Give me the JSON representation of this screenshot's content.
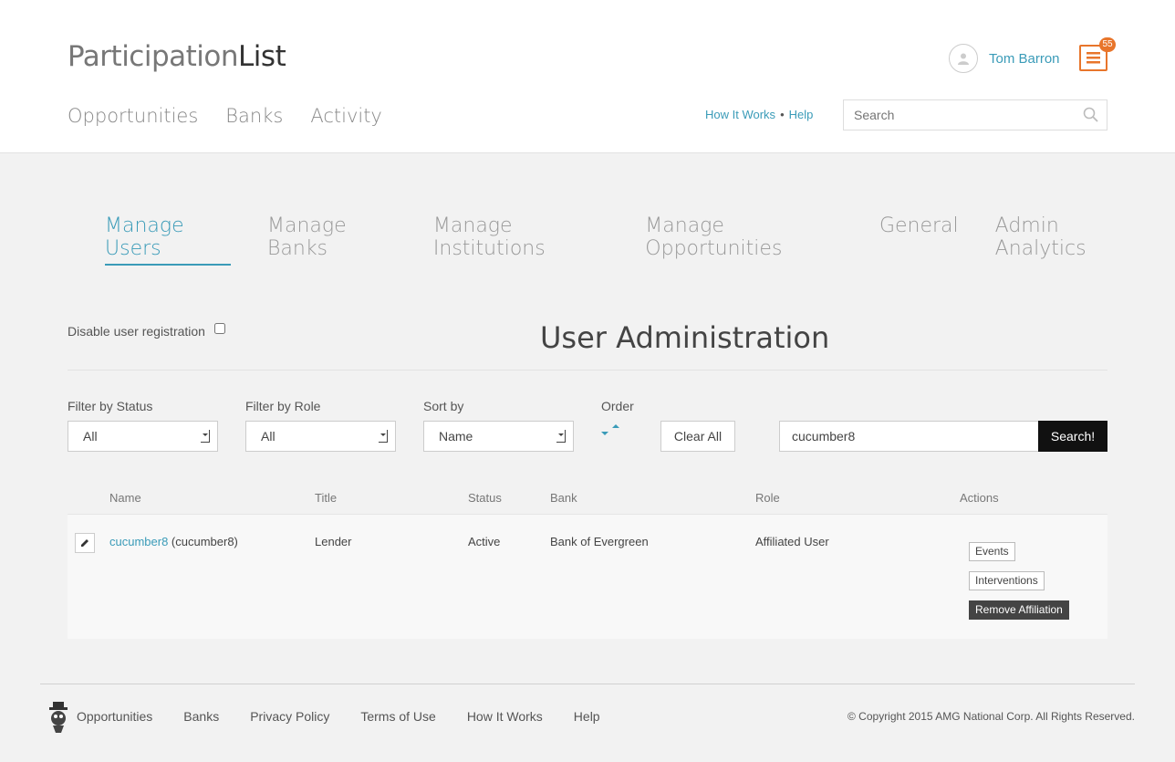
{
  "header": {
    "logo_light": "Participation",
    "logo_dark": "List",
    "nav": [
      "Opportunities",
      "Banks",
      "Activity"
    ],
    "user_name": "Tom Barron",
    "notification_count": "55",
    "help_links": [
      "How It Works",
      "Help"
    ],
    "search_placeholder": "Search"
  },
  "admin_tabs": [
    {
      "label": "Manage Users",
      "active": true
    },
    {
      "label": "Manage Banks",
      "active": false
    },
    {
      "label": "Manage Institutions",
      "active": false
    },
    {
      "label": "Manage Opportunities",
      "active": false
    },
    {
      "label": "General",
      "active": false
    },
    {
      "label": "Admin Analytics",
      "active": false
    }
  ],
  "disable_registration_label": "Disable user registration",
  "page_title": "User Administration",
  "filters": {
    "status": {
      "label": "Filter by Status",
      "value": "All"
    },
    "role": {
      "label": "Filter by Role",
      "value": "All"
    },
    "sort": {
      "label": "Sort by",
      "value": "Name"
    },
    "order_label": "Order",
    "clear_all": "Clear All",
    "search_value": "cucumber8",
    "search_button": "Search!"
  },
  "table": {
    "headers": [
      "Name",
      "Title",
      "Status",
      "Bank",
      "Role",
      "Actions"
    ],
    "rows": [
      {
        "name_link": "cucumber8",
        "name_extra": " (cucumber8)",
        "title": "Lender",
        "status": "Active",
        "bank": "Bank of Evergreen",
        "role": "Affiliated User",
        "actions": [
          "Events",
          "Interventions",
          "Remove Affiliation"
        ]
      }
    ]
  },
  "footer": {
    "nav": [
      "Opportunities",
      "Banks",
      "Privacy Policy",
      "Terms of Use",
      "How It Works",
      "Help"
    ],
    "copyright": "© Copyright 2015 AMG National Corp. All Rights Reserved."
  },
  "colors": {
    "accent": "#3a9bb8",
    "notification": "#e8752b",
    "search_button": "#111111",
    "danger_button": "#444444"
  }
}
